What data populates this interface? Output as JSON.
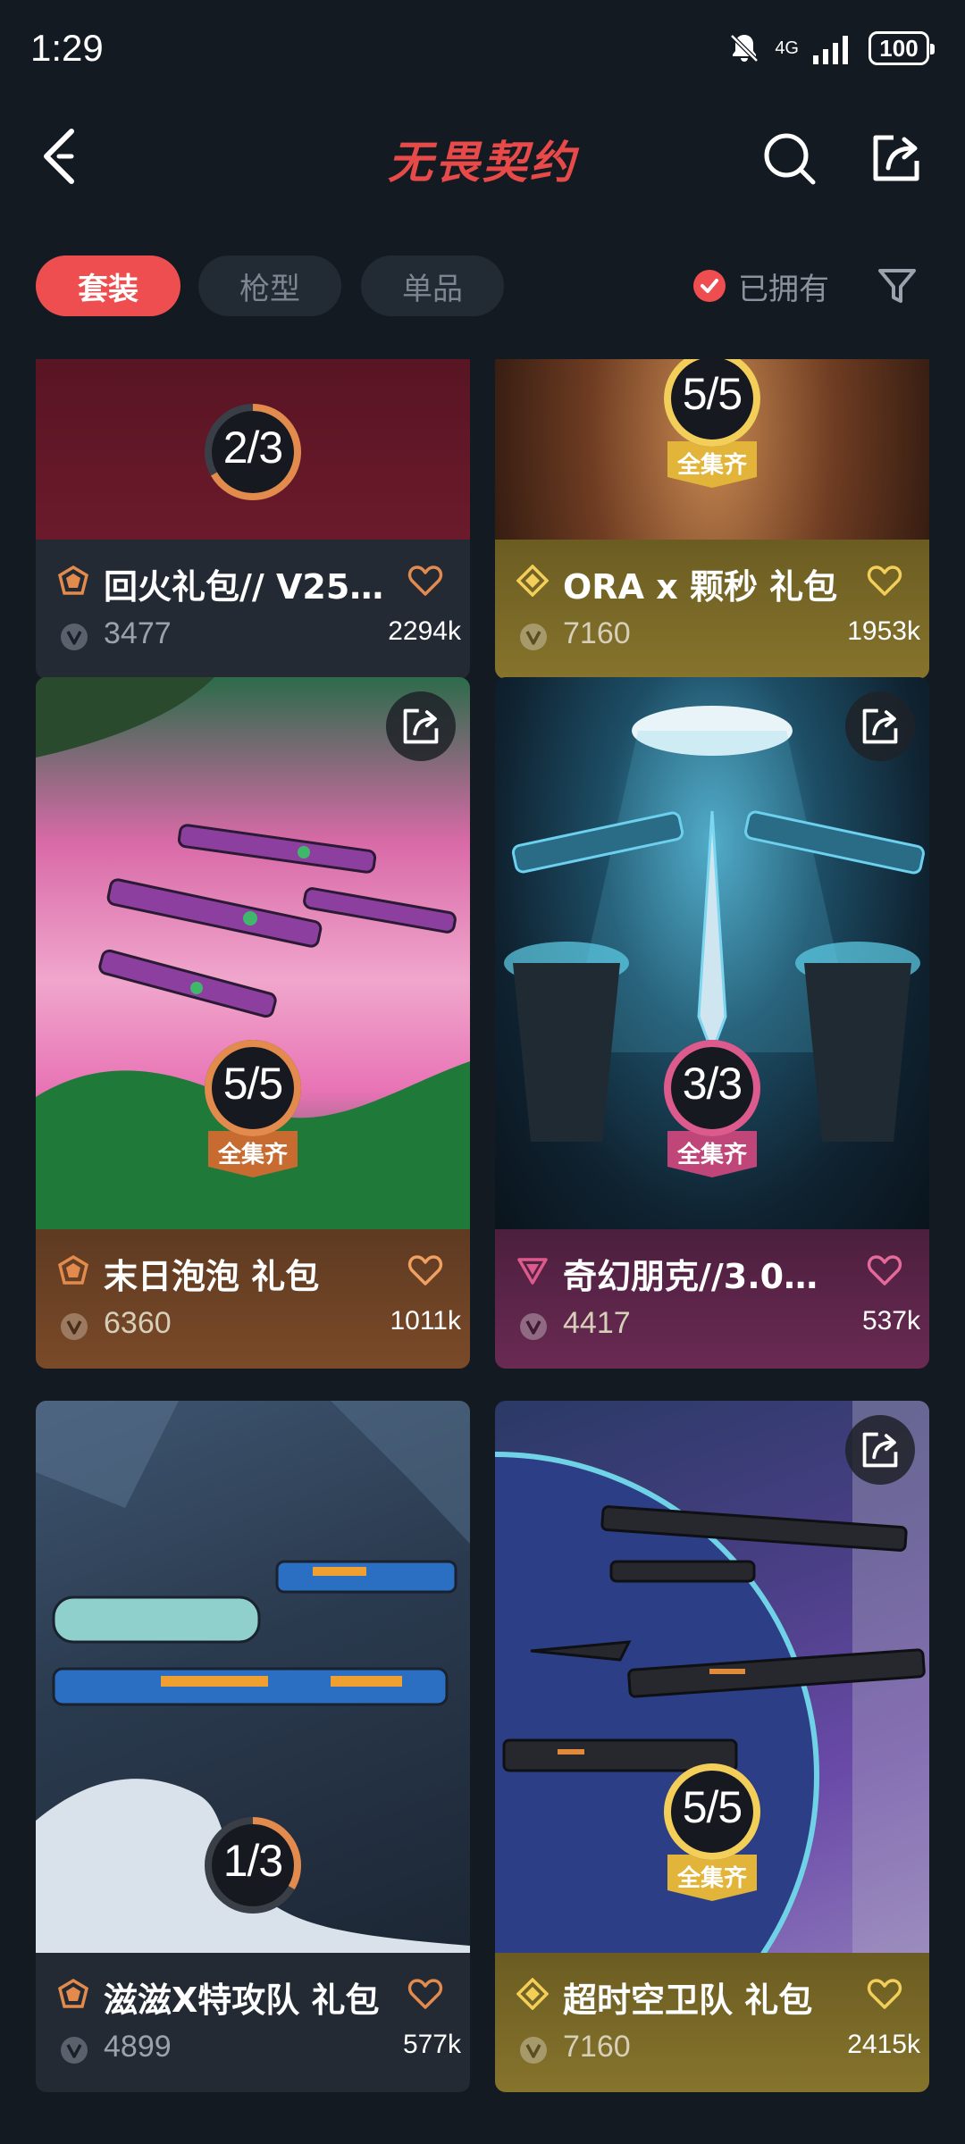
{
  "status_bar": {
    "time": "1:29",
    "network": "4G",
    "battery": "100"
  },
  "header": {
    "title": "无畏契约"
  },
  "filters": {
    "chips": [
      {
        "label": "套装",
        "active": true
      },
      {
        "label": "枪型",
        "active": false
      },
      {
        "label": "单品",
        "active": false
      }
    ],
    "owned_label": "已拥有",
    "owned_checked": true
  },
  "cards": [
    {
      "name": "回火礼包// V25…",
      "price": "3477",
      "likes": "2294k",
      "progress": "2/3",
      "progress_fraction": 0.667,
      "complete": false,
      "tier": "bronze",
      "complete_label": ""
    },
    {
      "name": "ORA x 颗秒 礼包",
      "price": "7160",
      "likes": "1953k",
      "progress": "5/5",
      "progress_fraction": 1.0,
      "complete": true,
      "tier": "gold",
      "complete_label": "全集齐"
    },
    {
      "name": "末日泡泡 礼包",
      "price": "6360",
      "likes": "1011k",
      "progress": "5/5",
      "progress_fraction": 1.0,
      "complete": true,
      "tier": "orange",
      "complete_label": "全集齐"
    },
    {
      "name": "奇幻朋克//3.0…",
      "price": "4417",
      "likes": "537k",
      "progress": "3/3",
      "progress_fraction": 1.0,
      "complete": true,
      "tier": "pink",
      "complete_label": "全集齐"
    },
    {
      "name": "滋滋X特攻队 礼包",
      "price": "4899",
      "likes": "577k",
      "progress": "1/3",
      "progress_fraction": 0.333,
      "complete": false,
      "tier": "bronze",
      "complete_label": ""
    },
    {
      "name": "超时空卫队 礼包",
      "price": "7160",
      "likes": "2415k",
      "progress": "5/5",
      "progress_fraction": 1.0,
      "complete": true,
      "tier": "gold",
      "complete_label": "全集齐"
    }
  ],
  "colors": {
    "accent": "#ef4e50",
    "background": "#141a22",
    "bronze_ring": "#e38a4d",
    "gold_ring": "#f3cf5a",
    "pink_ring": "#dc5a8c"
  }
}
